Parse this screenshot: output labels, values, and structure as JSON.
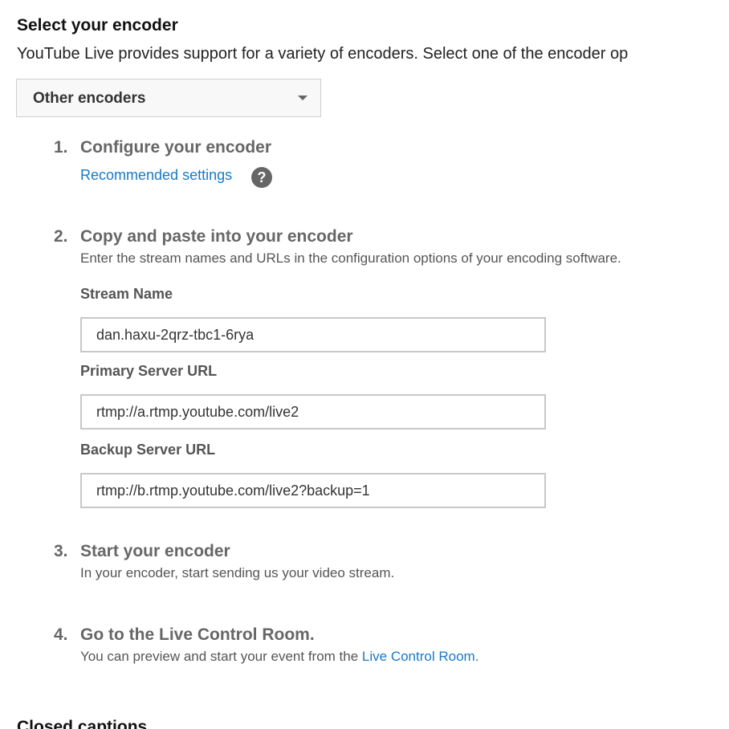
{
  "encoder_section": {
    "title": "Select your encoder",
    "description": "YouTube Live provides support for a variety of encoders. Select one of the encoder op",
    "selected_encoder": "Other encoders",
    "dropdown_icon": "chevron-down-icon"
  },
  "steps": [
    {
      "number": "1.",
      "title": "Configure your encoder",
      "link_label": "Recommended settings",
      "help_icon_glyph": "?"
    },
    {
      "number": "2.",
      "title": "Copy and paste into your encoder",
      "description": "Enter the stream names and URLs in the configuration options of your encoding software.",
      "fields": [
        {
          "label": "Stream Name",
          "value": "dan.haxu-2qrz-tbc1-6rya"
        },
        {
          "label": "Primary Server URL",
          "value": "rtmp://a.rtmp.youtube.com/live2"
        },
        {
          "label": "Backup Server URL",
          "value": "rtmp://b.rtmp.youtube.com/live2?backup=1"
        }
      ]
    },
    {
      "number": "3.",
      "title": "Start your encoder",
      "description": "In your encoder, start sending us your video stream."
    },
    {
      "number": "4.",
      "title": "Go to the Live Control Room.",
      "description": "You can preview and start your event from the ",
      "link_label": "Live Control Room."
    }
  ],
  "next_section": {
    "title": "Closed captions"
  },
  "colors": {
    "link": "#167ac6",
    "step_text": "#666666",
    "input_border": "#c8c8c8"
  }
}
